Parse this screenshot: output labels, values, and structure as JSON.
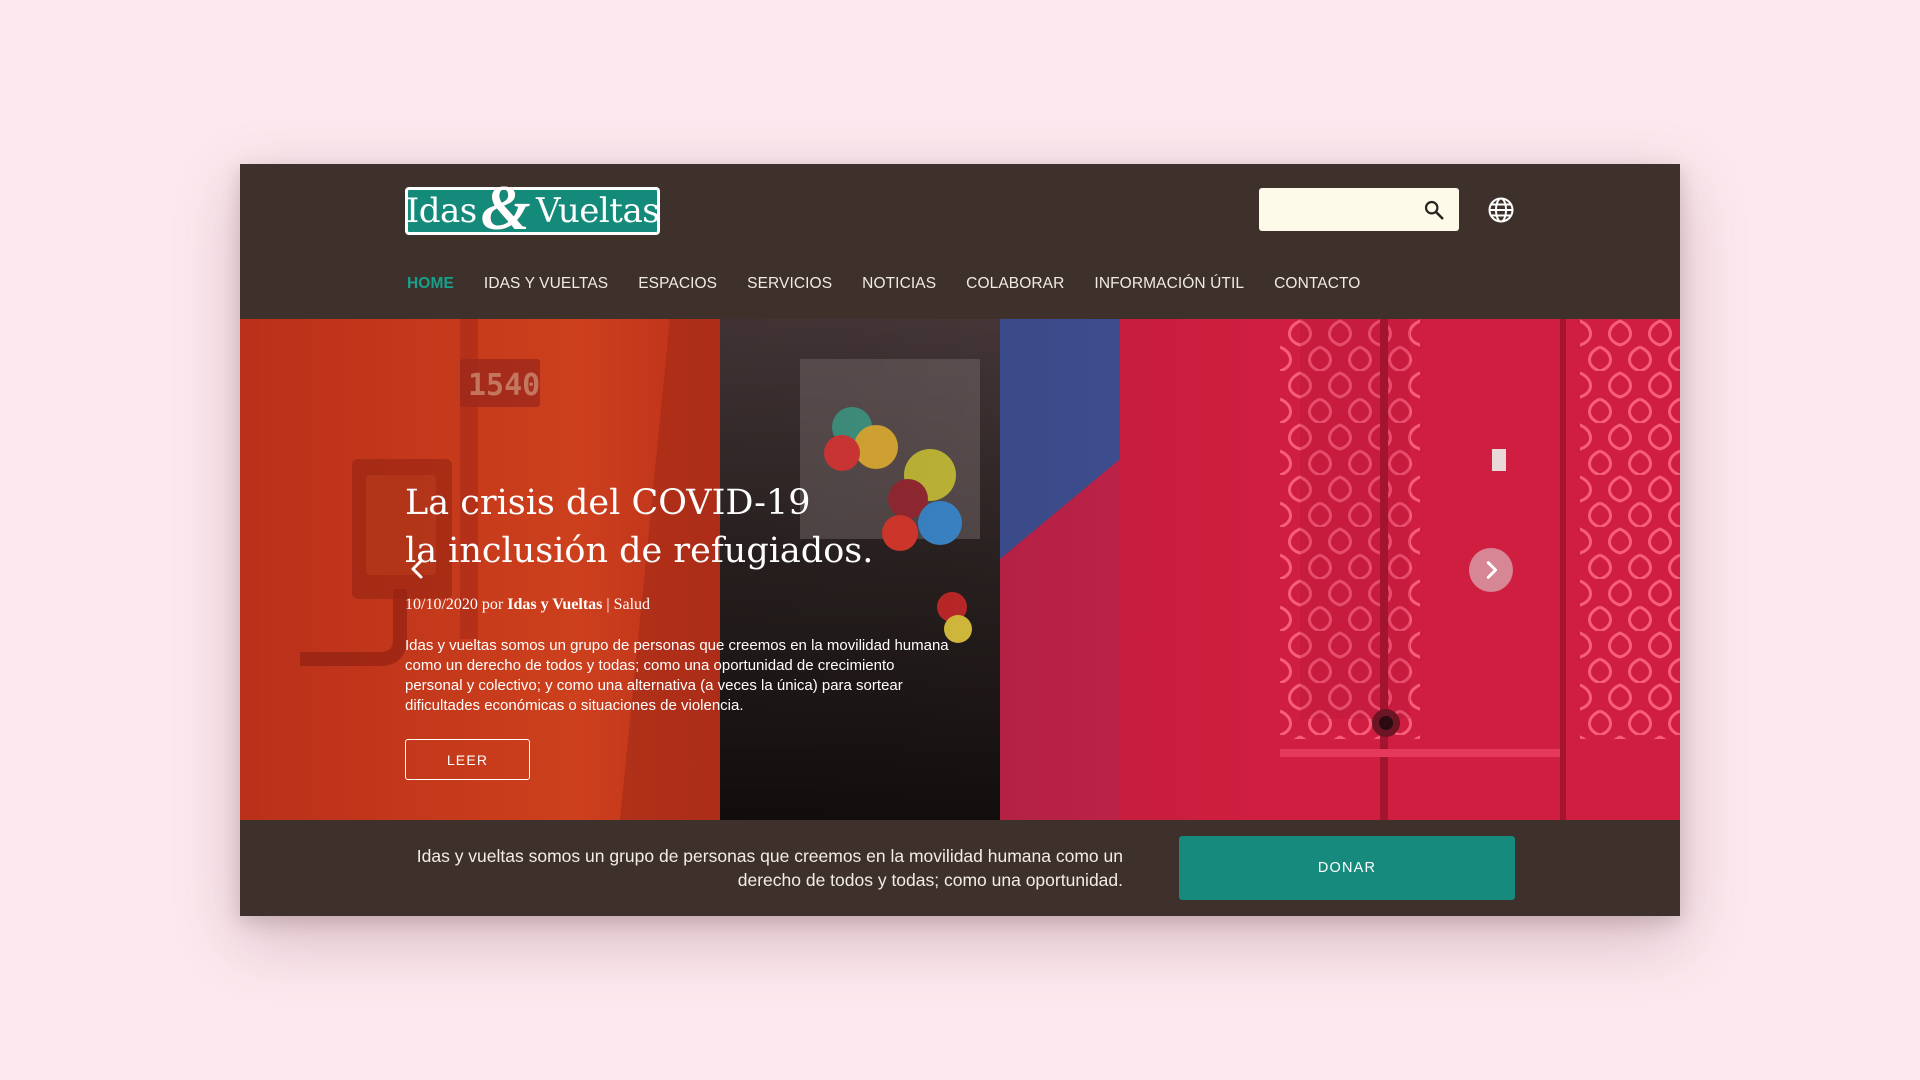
{
  "brand": {
    "logo_word1": "Idas",
    "logo_amp": "&",
    "logo_word2": "Vueltas"
  },
  "search": {
    "placeholder": "",
    "value": ""
  },
  "nav": {
    "items": [
      {
        "label": "HOME",
        "active": true
      },
      {
        "label": "IDAS Y VUELTAS"
      },
      {
        "label": "ESPACIOS"
      },
      {
        "label": "SERVICIOS"
      },
      {
        "label": "NOTICIAS"
      },
      {
        "label": "COLABORAR"
      },
      {
        "label": "INFORMACIÓN ÚTIL"
      },
      {
        "label": "CONTACTO"
      }
    ]
  },
  "hero": {
    "title_line1": "La crisis del COVID-19",
    "title_line2": "la inclusión de refugiados.",
    "date": "10/10/2020",
    "by": "por",
    "author": "Idas y Vueltas",
    "separator": "|",
    "category": "Salud",
    "excerpt": "Idas y vueltas somos un grupo de personas que creemos en la movilidad humana como un derecho de todos y todas; como una oportunidad de crecimiento personal y colectivo; y como una alternativa (a veces la única) para sortear dificultades económicas o situaciones de violencia.",
    "read_label": "LEER",
    "photo_number": "1540"
  },
  "band": {
    "text": "Idas y vueltas somos un grupo de personas que creemos en la movilidad humana como un derecho de todos y todas; como una oportunidad.",
    "donate_label": "DONAR"
  },
  "colors": {
    "page_bg": "#fce8ee",
    "header_bg": "#3e312c",
    "accent": "#168a7c",
    "nav_active": "#16a08d"
  },
  "icons": {
    "search": "search-icon",
    "language": "globe-icon",
    "prev": "chevron-left-icon",
    "next": "chevron-right-icon"
  }
}
